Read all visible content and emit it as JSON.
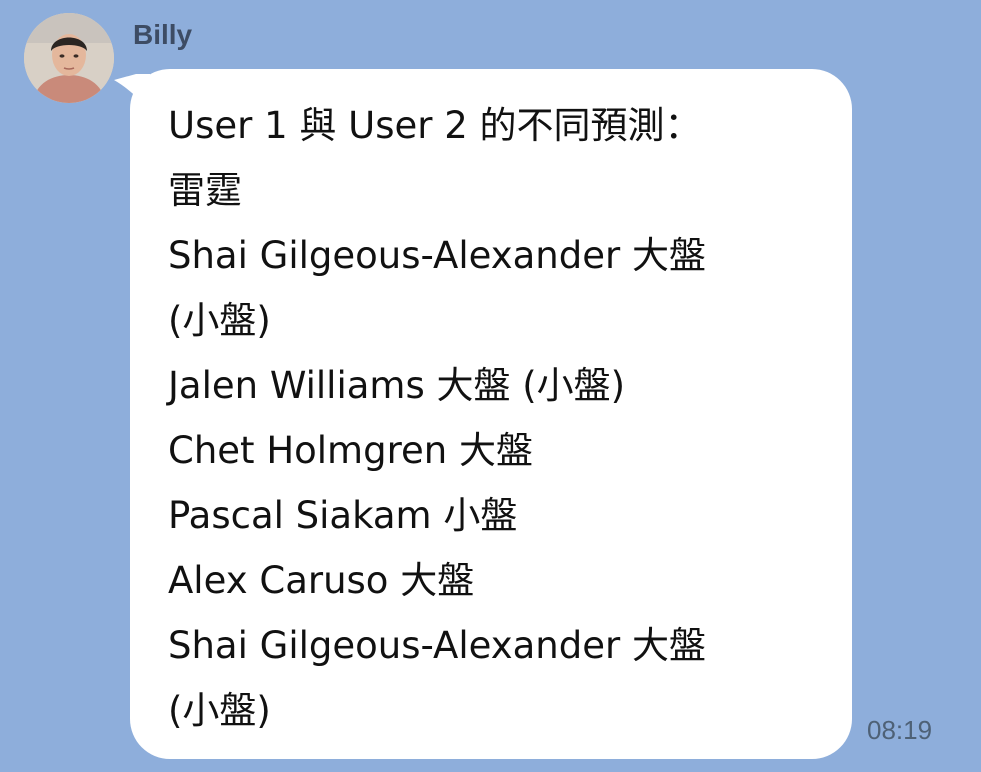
{
  "colors": {
    "chat_background": "#8eaedb",
    "bubble": "#ffffff",
    "sender_name": "#3d4c64",
    "message_text": "#111111",
    "timestamp": "#4e6176"
  },
  "message": {
    "sender": "Billy",
    "avatar_icon": "user-photo-avatar",
    "lines": [
      "User 1 與 User 2 的不同預測：",
      "雷霆",
      "Shai Gilgeous-Alexander 大盤",
      "(小盤)",
      "Jalen Williams 大盤 (小盤)",
      "Chet Holmgren 大盤",
      "Pascal Siakam 小盤",
      "Alex Caruso 大盤",
      "Shai Gilgeous-Alexander 大盤",
      "(小盤)"
    ],
    "time": "08:19"
  }
}
